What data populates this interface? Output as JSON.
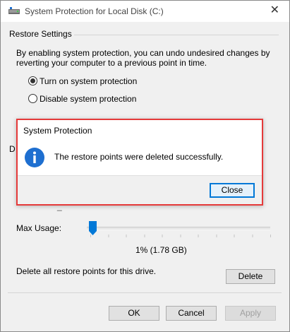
{
  "window": {
    "title": "System Protection for Local Disk (C:)",
    "close_glyph": "✕"
  },
  "restore_settings": {
    "group_label": "Restore Settings",
    "description_line1": "By enabling system protection, you can undo undesired changes by",
    "description_line2": "reverting your computer to a previous point in time.",
    "options": [
      {
        "label": "Turn on system protection",
        "selected": true
      },
      {
        "label": "Disable system protection",
        "selected": false
      }
    ]
  },
  "disk_space": {
    "group_label_partial": "D",
    "max_usage_label": "Max Usage:",
    "usage_value": "1% (1.78 GB)",
    "usage_fraction": 0.01,
    "delete_text": "Delete all restore points for this drive.",
    "delete_button": "Delete"
  },
  "footer": {
    "ok": "OK",
    "cancel": "Cancel",
    "apply": "Apply"
  },
  "dialog": {
    "title": "System Protection",
    "message": "The restore points were deleted successfully.",
    "close_button": "Close",
    "icon": "info-icon",
    "highlight_color": "#e53a3a",
    "accent_color": "#0078d7"
  }
}
